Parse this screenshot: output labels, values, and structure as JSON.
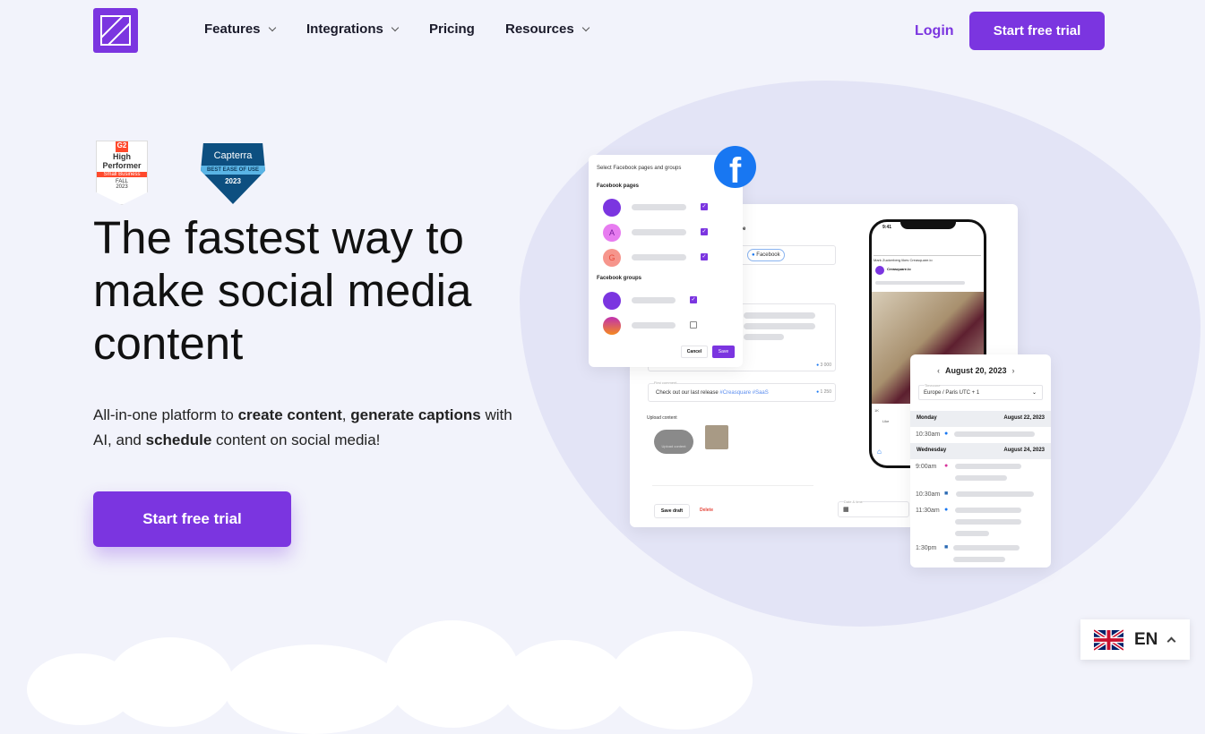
{
  "nav": {
    "items": [
      {
        "label": "Features",
        "dropdown": true
      },
      {
        "label": "Integrations",
        "dropdown": true
      },
      {
        "label": "Pricing",
        "dropdown": false
      },
      {
        "label": "Resources",
        "dropdown": true
      }
    ],
    "login": "Login",
    "cta": "Start free trial"
  },
  "badges": {
    "g2": {
      "brand": "G2",
      "title": "High Performer",
      "ribbon": "Small Business",
      "season": "FALL",
      "year": "2023"
    },
    "capterra": {
      "brand": "Capterra",
      "ribbon": "BEST EASE OF USE",
      "year": "2023"
    }
  },
  "hero": {
    "title": "The fastest way to make social media content",
    "sub_parts": [
      "All-in-one platform to ",
      "create content",
      ", ",
      "generate captions",
      " with AI, and ",
      "schedule",
      " content on social media!"
    ],
    "cta": "Start free trial"
  },
  "mock": {
    "fb_modal": {
      "title": "Select Facebook pages and groups",
      "pages_label": "Facebook pages",
      "groups_label": "Facebook groups",
      "avatars": [
        "A",
        "G"
      ],
      "cancel": "Cancel",
      "save": "Save"
    },
    "editor": {
      "partial_label": "date",
      "network_chip": "Facebook",
      "counter1": "3 000",
      "first_comment_label": "First comment",
      "first_comment": "Check out our last release ",
      "hashtags": "#Creasquare #SaaS",
      "counter2": "1 250",
      "upload_label": "Upload content",
      "upload_btn": "Upload content",
      "save_draft": "Save draft",
      "delete": "Delete",
      "date_label": "Date & time"
    },
    "phone": {
      "time": "9:41",
      "notice": "Mark Zuckerberg likes Creasquare.io",
      "account": "Creasquare.io",
      "reactions": "1K",
      "like": "Like"
    },
    "schedule": {
      "date": "August 20, 2023",
      "tz_label": "Timezone",
      "tz": "Europe / Paris UTC + 1",
      "days": [
        {
          "day": "Monday",
          "date": "August 22, 2023",
          "items": [
            {
              "time": "10:30am",
              "net": "facebook"
            }
          ]
        },
        {
          "day": "Wednesday",
          "date": "August 24, 2023",
          "items": [
            {
              "time": "9:00am",
              "net": "instagram"
            },
            {
              "time": "10:30am",
              "net": "linkedin"
            },
            {
              "time": "11:30am",
              "net": "facebook"
            },
            {
              "time": "1:30pm",
              "net": "linkedin"
            }
          ]
        }
      ]
    }
  },
  "lang": {
    "code": "EN"
  },
  "colors": {
    "brand": "#7b35e0",
    "facebook": "#1877f2",
    "bg": "#f2f3fb"
  }
}
